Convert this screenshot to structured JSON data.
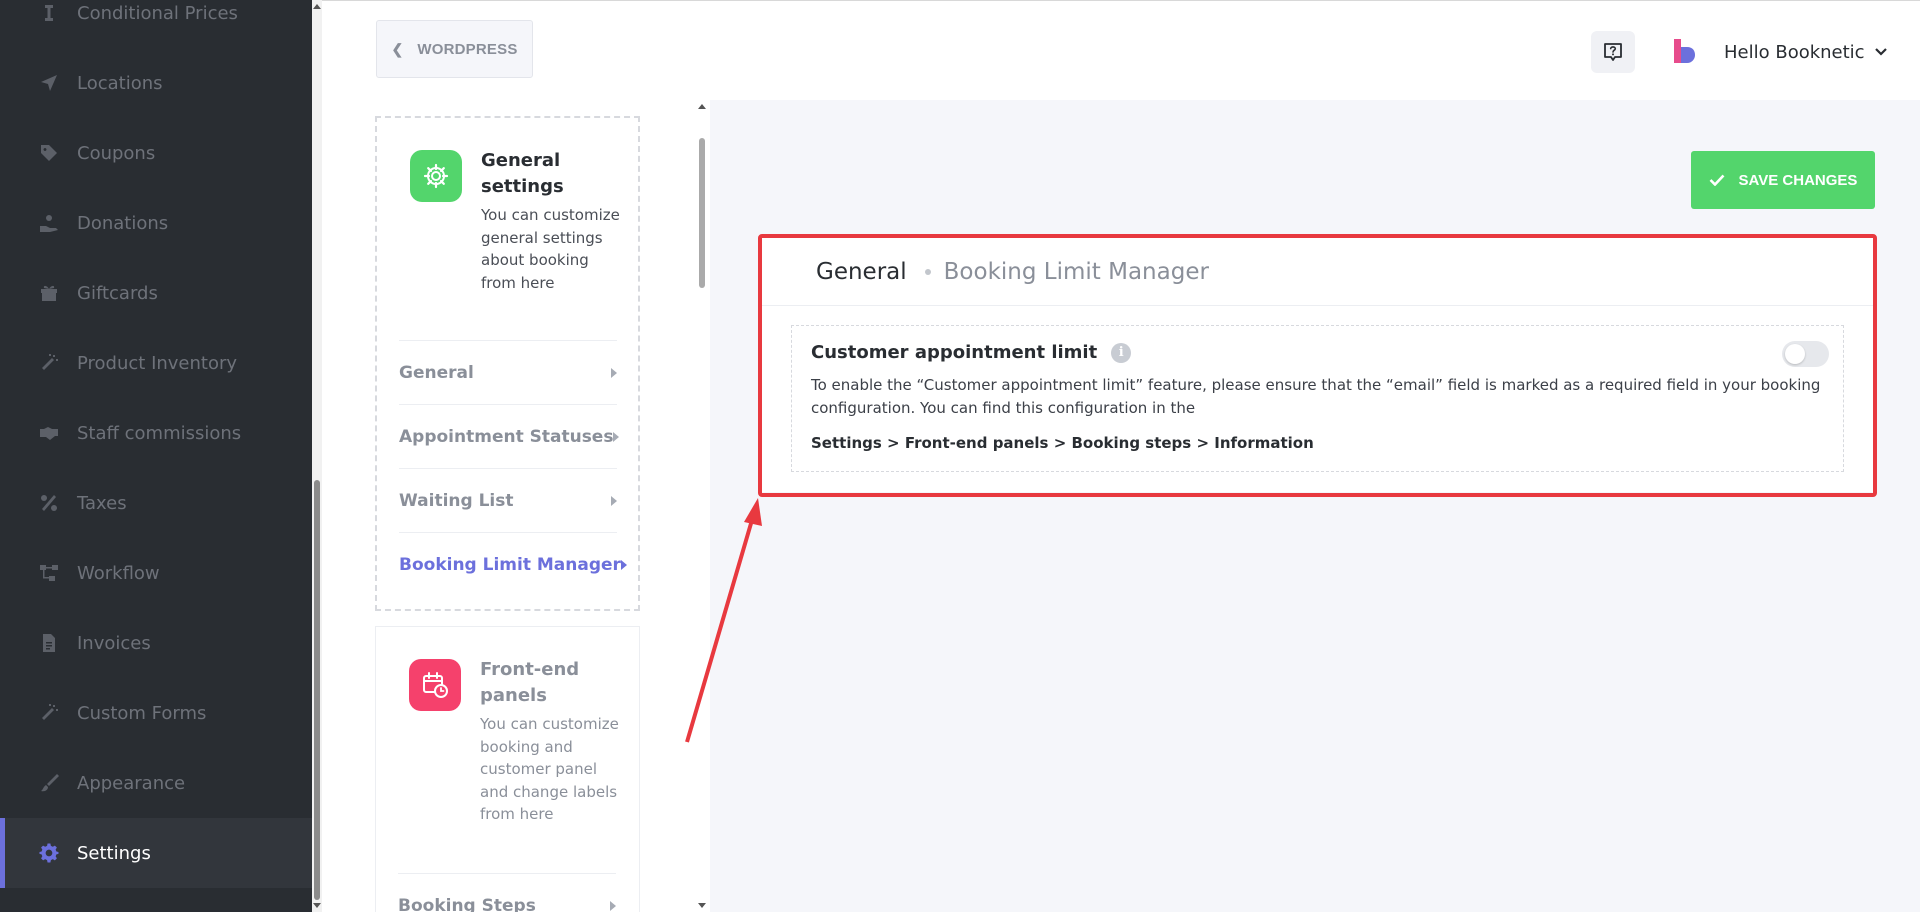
{
  "sidebar": {
    "items": [
      {
        "label": "Conditional Prices",
        "icon": "price-cursor-icon"
      },
      {
        "label": "Locations",
        "icon": "location-arrow-icon"
      },
      {
        "label": "Coupons",
        "icon": "tag-icon"
      },
      {
        "label": "Donations",
        "icon": "donation-hand-icon"
      },
      {
        "label": "Giftcards",
        "icon": "gift-icon"
      },
      {
        "label": "Product Inventory",
        "icon": "magic-wand-icon"
      },
      {
        "label": "Staff commissions",
        "icon": "handshake-icon"
      },
      {
        "label": "Taxes",
        "icon": "percent-icon"
      },
      {
        "label": "Workflow",
        "icon": "workflow-icon"
      },
      {
        "label": "Invoices",
        "icon": "invoice-file-icon"
      },
      {
        "label": "Custom Forms",
        "icon": "magic-wand-icon"
      },
      {
        "label": "Appearance",
        "icon": "paint-brush-icon"
      },
      {
        "label": "Settings",
        "icon": "gear-icon",
        "active": true
      }
    ]
  },
  "header": {
    "back_label": "WORDPRESS",
    "help_icon": "question-chat-icon",
    "user_greeting": "Hello Booknetic"
  },
  "settings_panel": {
    "general_card": {
      "title": "General settings",
      "description": "You can customize general settings about booking from here",
      "items": [
        {
          "label": "General"
        },
        {
          "label": "Appointment Statuses"
        },
        {
          "label": "Waiting List"
        },
        {
          "label": "Booking Limit Manager",
          "active": true
        }
      ]
    },
    "frontend_card": {
      "title": "Front-end panels",
      "description": "You can customize booking and customer panel and change labels from here",
      "items": [
        {
          "label": "Booking Steps"
        }
      ]
    }
  },
  "main": {
    "save_label": "SAVE CHANGES",
    "breadcrumb_root": "General",
    "breadcrumb_current": "Booking Limit Manager",
    "option": {
      "title": "Customer appointment limit",
      "enabled": false,
      "description": "To enable the “Customer appointment limit” feature, please ensure that the “email” field is marked as a required field in your booking configuration. You can find this configuration in the",
      "path": "Settings > Front-end panels > Booking steps > Information"
    }
  },
  "colors": {
    "accent": "#6c70dc",
    "sidebar_bg": "#292d32",
    "save_green": "#53d56c",
    "highlight_red": "#e8393f",
    "general_icon_bg": "#53d56c",
    "frontend_icon_bg": "#f5416c"
  }
}
